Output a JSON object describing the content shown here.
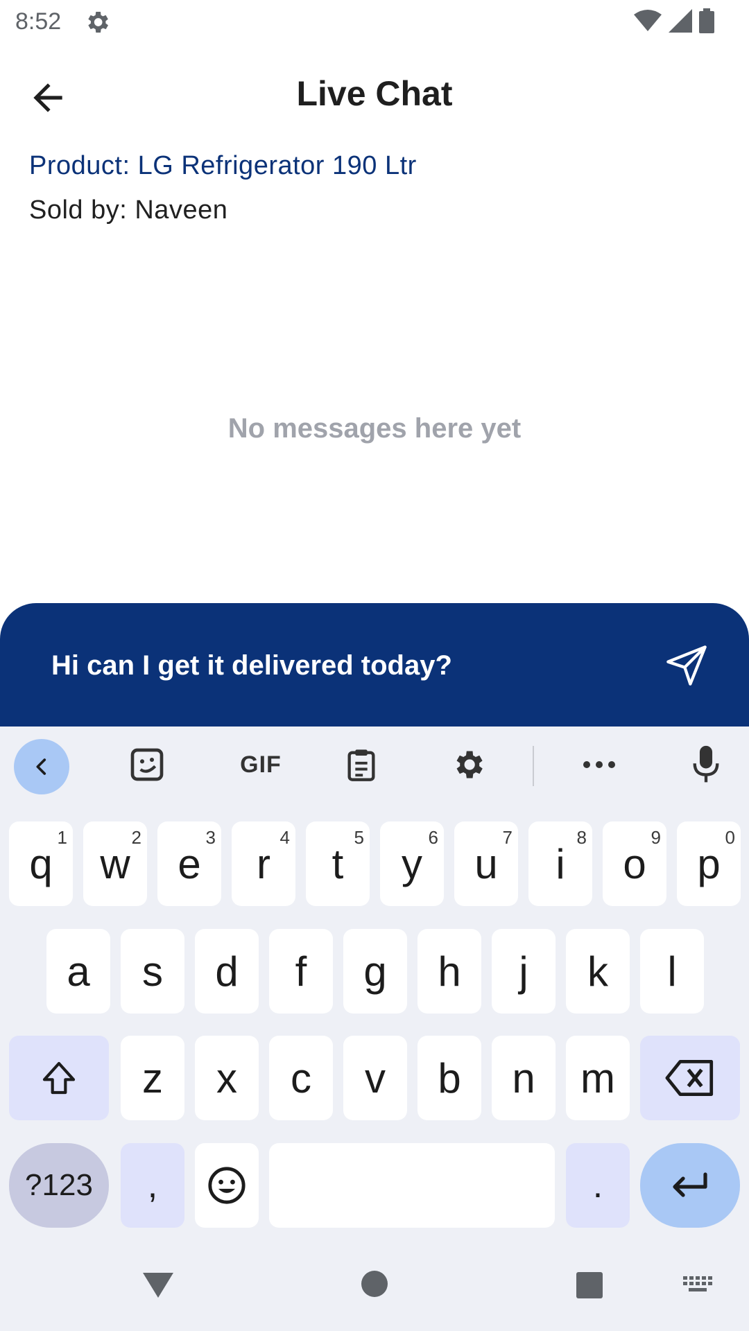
{
  "status_bar": {
    "time": "8:52",
    "icons": [
      "settings-icon",
      "wifi-icon",
      "signal-icon",
      "battery-icon"
    ]
  },
  "header": {
    "title": "Live Chat",
    "back_icon": "arrow-left-icon"
  },
  "product": {
    "product_line": "Product: LG Refrigerator 190 Ltr",
    "seller_line": "Sold by: Naveen"
  },
  "chat": {
    "empty_text": "No messages here yet"
  },
  "composer": {
    "input_value": "Hi can I get it delivered today?",
    "send_icon": "send-icon"
  },
  "keyboard": {
    "toolbar": {
      "gif_label": "GIF",
      "icons": [
        "chevron-left-icon",
        "sticker-icon",
        "clipboard-icon",
        "gear-icon",
        "more-icon",
        "mic-icon"
      ]
    },
    "row1": [
      {
        "key": "q",
        "hint": "1"
      },
      {
        "key": "w",
        "hint": "2"
      },
      {
        "key": "e",
        "hint": "3"
      },
      {
        "key": "r",
        "hint": "4"
      },
      {
        "key": "t",
        "hint": "5"
      },
      {
        "key": "y",
        "hint": "6"
      },
      {
        "key": "u",
        "hint": "7"
      },
      {
        "key": "i",
        "hint": "8"
      },
      {
        "key": "o",
        "hint": "9"
      },
      {
        "key": "p",
        "hint": "0"
      }
    ],
    "row2": [
      "a",
      "s",
      "d",
      "f",
      "g",
      "h",
      "j",
      "k",
      "l"
    ],
    "row3": [
      "z",
      "x",
      "c",
      "v",
      "b",
      "n",
      "m"
    ],
    "row4": {
      "numbers_label": "?123",
      "comma": ",",
      "period": "."
    }
  },
  "colors": {
    "brand": "#0b3278",
    "keyboard_bg": "#eef0f6",
    "accent_key": "#a9c8f5"
  }
}
